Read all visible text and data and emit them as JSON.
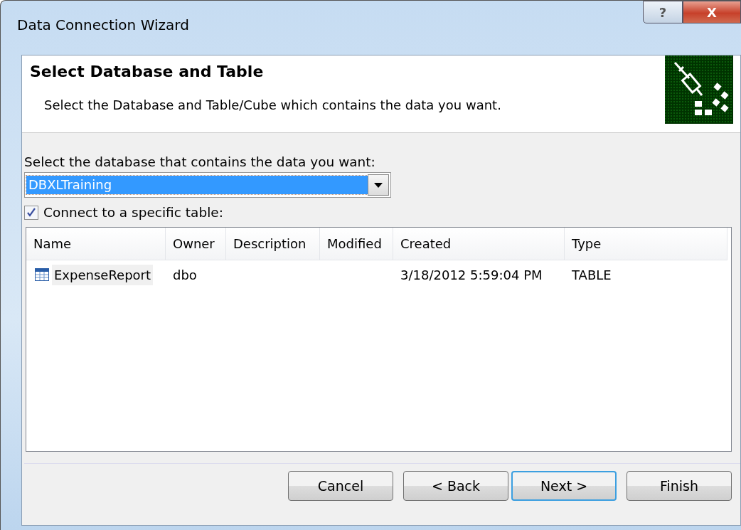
{
  "window": {
    "title": "Data Connection Wizard",
    "buttons": [
      {
        "kind": "help",
        "label": "?"
      },
      {
        "kind": "close",
        "label": "X"
      }
    ]
  },
  "header": {
    "title": "Select Database and Table",
    "subtitle": "Select the Database and Table/Cube which contains the data you want."
  },
  "database": {
    "label": "Select the database that contains the data you want:",
    "value": "DBXLTraining",
    "selected": true
  },
  "specific_table": {
    "label": "Connect to a specific table:",
    "checked": true
  },
  "table": {
    "columns": [
      "Name",
      "Owner",
      "Description",
      "Modified",
      "Created",
      "Type"
    ],
    "rows": [
      {
        "cells": [
          "ExpenseReport",
          "dbo",
          "",
          "",
          "3/18/2012 5:59:04 PM",
          "TABLE"
        ],
        "selected": false
      }
    ]
  },
  "buttons": [
    {
      "label": "Cancel",
      "default": false
    },
    {
      "label": "< Back",
      "default": false
    },
    {
      "label": "Next >",
      "default": true
    },
    {
      "label": "Finish",
      "default": false
    }
  ]
}
